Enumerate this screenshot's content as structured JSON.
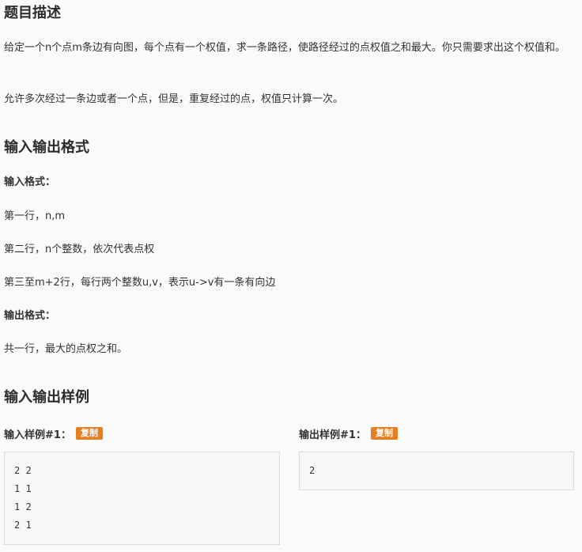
{
  "sections": {
    "description_title": "题目描述",
    "description_p1": "给定一个n个点m条边有向图，每个点有一个权值，求一条路径，使路径经过的点权值之和最大。你只需要求出这个权值和。",
    "description_p2": "允许多次经过一条边或者一个点，但是，重复经过的点，权值只计算一次。",
    "io_title": "输入输出格式",
    "input_format_label": "输入格式：",
    "input_line1": "第一行，n,m",
    "input_line2": "第二行，n个整数，依次代表点权",
    "input_line3": "第三至m+2行，每行两个整数u,v，表示u->v有一条有向边",
    "output_format_label": "输出格式：",
    "output_line1": "共一行，最大的点权之和。",
    "samples_title": "输入输出样例"
  },
  "samples": {
    "input_label": "输入样例#1：",
    "output_label": "输出样例#1：",
    "copy_label": "复制",
    "input_lines": [
      "2 2",
      "1 1",
      "1 2",
      "2 1"
    ],
    "output_lines": [
      "2"
    ]
  },
  "colors": {
    "copy_button": "#e67e22"
  }
}
